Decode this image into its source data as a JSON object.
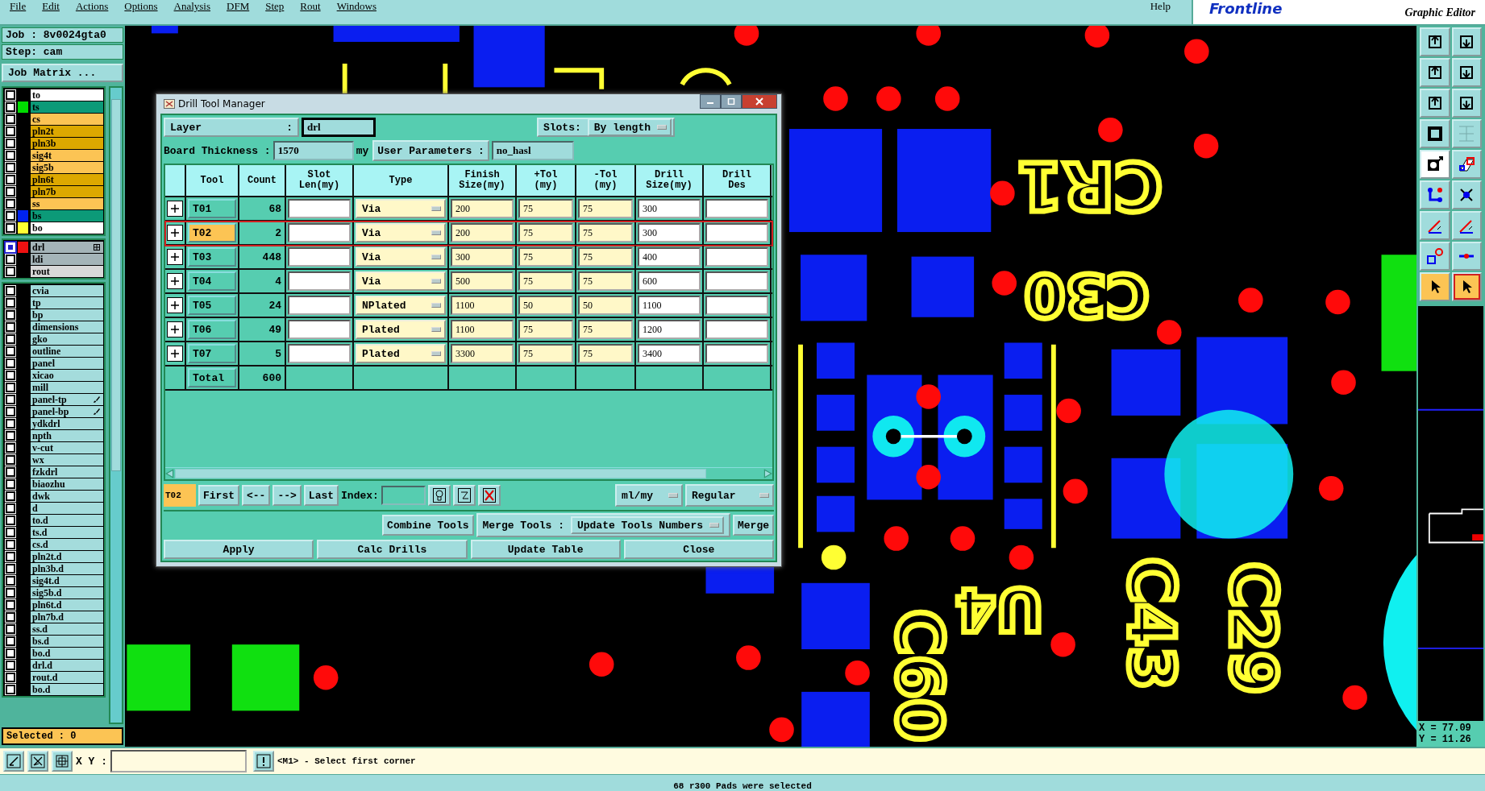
{
  "menu": [
    "File",
    "Edit",
    "Actions",
    "Options",
    "Analysis",
    "DFM",
    "Step",
    "Rout",
    "Windows"
  ],
  "help": "Help",
  "logo": {
    "name": "Frontline",
    "subtitle": "Graphic Editor"
  },
  "job": "Job : 8v0024gta0",
  "step": "Step: cam",
  "job_matrix_button": "Job Matrix ...",
  "layer_groups": [
    [
      {
        "name": "to",
        "kind": "silk",
        "selected": false
      },
      {
        "name": "ts",
        "kind": "mask",
        "color": "#00dd00",
        "selected": false
      },
      {
        "name": "cs",
        "kind": "signal",
        "selected": false
      },
      {
        "name": "pln2t",
        "kind": "plane",
        "selected": false
      },
      {
        "name": "pln3b",
        "kind": "plane",
        "selected": false
      },
      {
        "name": "sig4t",
        "kind": "signal",
        "selected": false
      },
      {
        "name": "sig5b",
        "kind": "signal",
        "selected": false
      },
      {
        "name": "pln6t",
        "kind": "plane",
        "selected": false
      },
      {
        "name": "pln7b",
        "kind": "plane",
        "selected": false
      },
      {
        "name": "ss",
        "kind": "signal",
        "selected": false
      },
      {
        "name": "bs",
        "kind": "mask",
        "color": "#0022ee",
        "selected": false
      },
      {
        "name": "bo",
        "kind": "silk",
        "color": "#ffff33",
        "selected": false
      }
    ],
    [
      {
        "name": "drl",
        "kind": "drill",
        "color": "#ee1111",
        "selected": true,
        "expandable": true
      },
      {
        "name": "ldi",
        "kind": "drill",
        "selected": false
      },
      {
        "name": "rout",
        "kind": "rout",
        "selected": false
      }
    ],
    [
      {
        "name": "cvia",
        "kind": "misc",
        "selected": false
      },
      {
        "name": "tp",
        "kind": "misc",
        "selected": false
      },
      {
        "name": "bp",
        "kind": "misc",
        "selected": false
      },
      {
        "name": "dimensions",
        "kind": "misc",
        "selected": false
      },
      {
        "name": "gko",
        "kind": "misc",
        "selected": false
      },
      {
        "name": "outline",
        "kind": "misc",
        "selected": false
      },
      {
        "name": "panel",
        "kind": "misc",
        "selected": false
      },
      {
        "name": "xicao",
        "kind": "misc",
        "selected": false
      },
      {
        "name": "mill",
        "kind": "misc",
        "selected": false
      },
      {
        "name": "panel-tp",
        "kind": "misc",
        "selected": false,
        "editable": true
      },
      {
        "name": "panel-bp",
        "kind": "misc",
        "selected": false,
        "editable": true
      },
      {
        "name": "ydkdrl",
        "kind": "misc",
        "selected": false
      },
      {
        "name": "npth",
        "kind": "misc",
        "selected": false
      },
      {
        "name": "v-cut",
        "kind": "misc",
        "selected": false
      },
      {
        "name": "wx",
        "kind": "misc",
        "selected": false
      },
      {
        "name": "fzkdrl",
        "kind": "misc",
        "selected": false
      },
      {
        "name": "biaozhu",
        "kind": "misc",
        "selected": false
      },
      {
        "name": "dwk",
        "kind": "misc",
        "selected": false
      },
      {
        "name": "d",
        "kind": "misc",
        "selected": false
      },
      {
        "name": "to.d",
        "kind": "misc",
        "selected": false
      },
      {
        "name": "ts.d",
        "kind": "misc",
        "selected": false
      },
      {
        "name": "cs.d",
        "kind": "misc",
        "selected": false
      },
      {
        "name": "pln2t.d",
        "kind": "misc",
        "selected": false
      },
      {
        "name": "pln3b.d",
        "kind": "misc",
        "selected": false
      },
      {
        "name": "sig4t.d",
        "kind": "misc",
        "selected": false
      },
      {
        "name": "sig5b.d",
        "kind": "misc",
        "selected": false
      },
      {
        "name": "pln6t.d",
        "kind": "misc",
        "selected": false
      },
      {
        "name": "pln7b.d",
        "kind": "misc",
        "selected": false
      },
      {
        "name": "ss.d",
        "kind": "misc",
        "selected": false
      },
      {
        "name": "bs.d",
        "kind": "misc",
        "selected": false
      },
      {
        "name": "bo.d",
        "kind": "misc",
        "selected": false
      },
      {
        "name": "drl.d",
        "kind": "misc",
        "selected": false
      },
      {
        "name": "rout.d",
        "kind": "misc",
        "selected": false
      },
      {
        "name": "bo.d",
        "kind": "misc",
        "selected": false
      }
    ]
  ],
  "selected_count": "Selected : 0",
  "board_labels": [
    "CR1",
    "C30",
    "U4",
    "C60",
    "C43",
    "C29"
  ],
  "dialog": {
    "title": "Drill Tool Manager",
    "layer_label": "Layer",
    "layer_colon": ":",
    "layer_value": "drl",
    "slots_label": "Slots:",
    "slots_value": "By length",
    "thickness_label": "Board Thickness :",
    "thickness_value": "1570",
    "thickness_unit": "my",
    "user_params_button": "User Parameters :",
    "user_params_value": "no_hasl",
    "columns": [
      "Tool",
      "Count",
      "Slot\nLen(my)",
      "Type",
      "Finish\nSize(my)",
      "+Tol\n(my)",
      "-Tol\n(my)",
      "Drill\nSize(my)",
      "Drill\nDes"
    ],
    "rows": [
      {
        "tool": "T01",
        "count": "68",
        "type": "Via",
        "finish": "200",
        "plus_tol": "75",
        "minus_tol": "75",
        "drill": "300",
        "selected": false
      },
      {
        "tool": "T02",
        "count": "2",
        "type": "Via",
        "finish": "200",
        "plus_tol": "75",
        "minus_tol": "75",
        "drill": "300",
        "selected": true
      },
      {
        "tool": "T03",
        "count": "448",
        "type": "Via",
        "finish": "300",
        "plus_tol": "75",
        "minus_tol": "75",
        "drill": "400",
        "selected": false
      },
      {
        "tool": "T04",
        "count": "4",
        "type": "Via",
        "finish": "500",
        "plus_tol": "75",
        "minus_tol": "75",
        "drill": "600",
        "selected": false
      },
      {
        "tool": "T05",
        "count": "24",
        "type": "NPlated",
        "finish": "1100",
        "plus_tol": "50",
        "minus_tol": "50",
        "drill": "1100",
        "selected": false
      },
      {
        "tool": "T06",
        "count": "49",
        "type": "Plated",
        "finish": "1100",
        "plus_tol": "75",
        "minus_tol": "75",
        "drill": "1200",
        "selected": false
      },
      {
        "tool": "T07",
        "count": "5",
        "type": "Plated",
        "finish": "3300",
        "plus_tol": "75",
        "minus_tol": "75",
        "drill": "3400",
        "selected": false
      }
    ],
    "total_label": "Total",
    "total_count": "600",
    "current_tool": "T02",
    "nav_buttons": [
      "First",
      "<--",
      "-->",
      "Last"
    ],
    "index_label": "Index:",
    "units": "ml/my",
    "mode": "Regular",
    "combine_button": "Combine Tools",
    "merge_label": "Merge Tools :",
    "merge_option": "Update Tools Numbers",
    "merge_button": "Merge",
    "actions": [
      "Apply",
      "Calc Drills",
      "Update Table",
      "Close"
    ]
  },
  "coords": {
    "x": "X = 77.09",
    "y": "Y = 11.26"
  },
  "command": {
    "xy_label": "X Y :",
    "prompt": "<M1> - Select first corner"
  },
  "status": "68 r300 Pads were selected"
}
